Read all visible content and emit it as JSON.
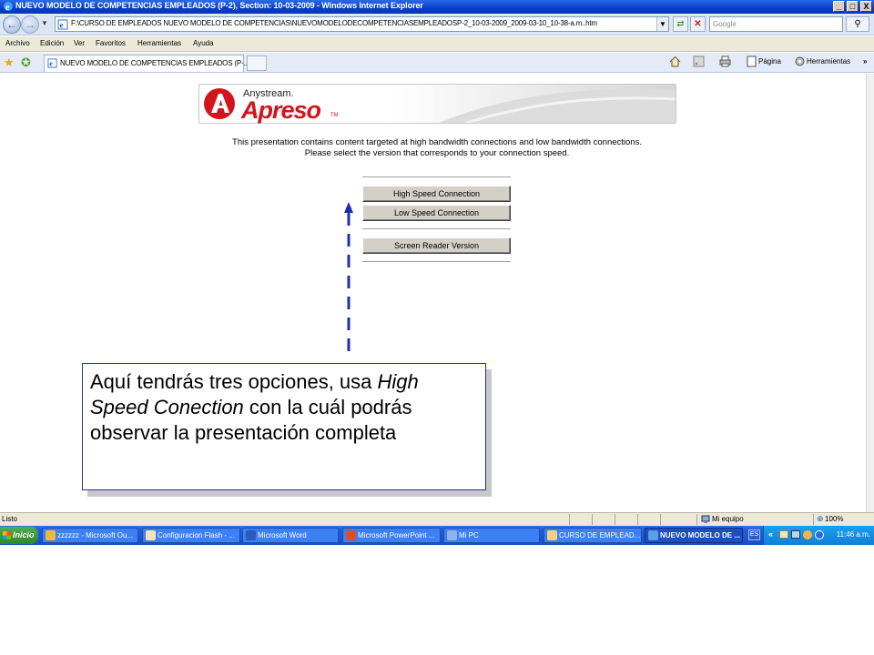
{
  "window": {
    "title": "NUEVO MODELO DE COMPETENCIAS EMPLEADOS (P-2), Section: 10-03-2009 - Windows Internet Explorer",
    "minimize": "_",
    "maximize": "□",
    "close": "X"
  },
  "address_bar": {
    "url": "F:\\CURSO DE EMPLEADOS NUEVO MODELO DE COMPETENCIAS\\NUEVOMODELODECOMPETENCIASEMPLEADOSP-2_10-03-2009_2009-03-10_10-38-a.m..htm",
    "search_placeholder": "Google"
  },
  "menu": [
    "Archivo",
    "Edición",
    "Ver",
    "Favoritos",
    "Herramientas",
    "Ayuda"
  ],
  "tab": {
    "label": "NUEVO MODELO DE COMPETENCIAS EMPLEADOS (P-..."
  },
  "command_bar": {
    "page": "Página",
    "tools": "Herramientas",
    "more": "»"
  },
  "page": {
    "logo_small": "Anystream.",
    "logo_big": "Apreso",
    "logo_tm": "TM",
    "intro_line1": "This presentation contains content targeted at high bandwidth connections and low bandwidth connections.",
    "intro_line2": "Please select the version that corresponds to your connection speed.",
    "options": {
      "high": "High Speed Connection",
      "low": "Low Speed Connection",
      "reader": "Screen Reader Version"
    },
    "callout": {
      "part1": "Aquí tendrás tres opciones, usa ",
      "emph": "High Speed Conection",
      "part2": " con la cuál podrás observar la presentación completa"
    }
  },
  "status_bar": {
    "status": "Listo",
    "zone": "Mi equipo",
    "zoom": "100%"
  },
  "taskbar": {
    "start": "Inicio",
    "items": [
      {
        "label": "zzzzzz - Microsoft Ou...",
        "color": "#f3b63a"
      },
      {
        "label": "Configuracion Flash - ...",
        "color": "#f5e6b0"
      },
      {
        "label": "Microsoft Word",
        "color": "#2a5bbd"
      },
      {
        "label": "Microsoft PowerPoint ...",
        "color": "#d9522b"
      },
      {
        "label": "Mi PC",
        "color": "#8fb3e8"
      },
      {
        "label": "CURSO DE EMPLEAD...",
        "color": "#f2d27a"
      },
      {
        "label": "NUEVO MODELO DE ...",
        "color": "#5aa0e6"
      }
    ],
    "lang": "ES",
    "chevron": "«",
    "clock": "11:46 a.m."
  },
  "colors": {
    "titlebar": "#0a3fc8",
    "logo_red": "#d4141c",
    "callout_border": "#1d2fb0",
    "arrow": "#1d2fb0"
  }
}
